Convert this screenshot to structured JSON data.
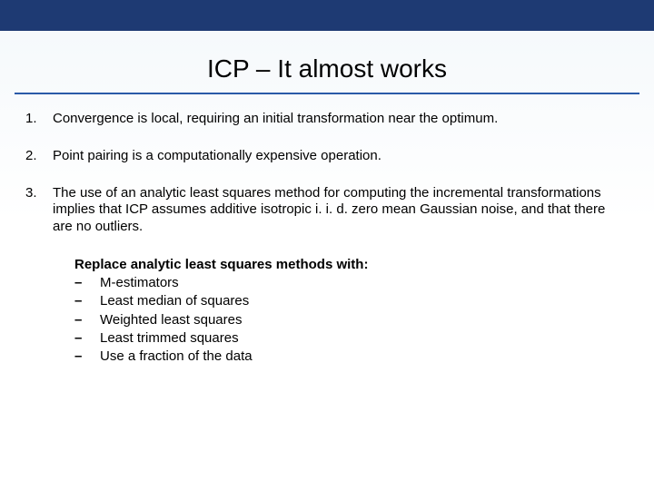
{
  "title": "ICP – It almost works",
  "items": [
    {
      "n": "1.",
      "text": "Convergence is local, requiring an initial transformation near the optimum."
    },
    {
      "n": "2.",
      "text": "Point pairing is a computationally expensive operation."
    },
    {
      "n": "3.",
      "text": "The use of an analytic least squares method for computing the incremental transformations implies that ICP  assumes additive isotropic i. i. d. zero mean Gaussian noise, and that there are no outliers."
    }
  ],
  "replace": {
    "heading": "Replace analytic least squares methods with:",
    "subs": [
      "M-estimators",
      "Least median of squares",
      "Weighted least squares",
      "Least trimmed squares",
      "Use a fraction of the data"
    ]
  }
}
